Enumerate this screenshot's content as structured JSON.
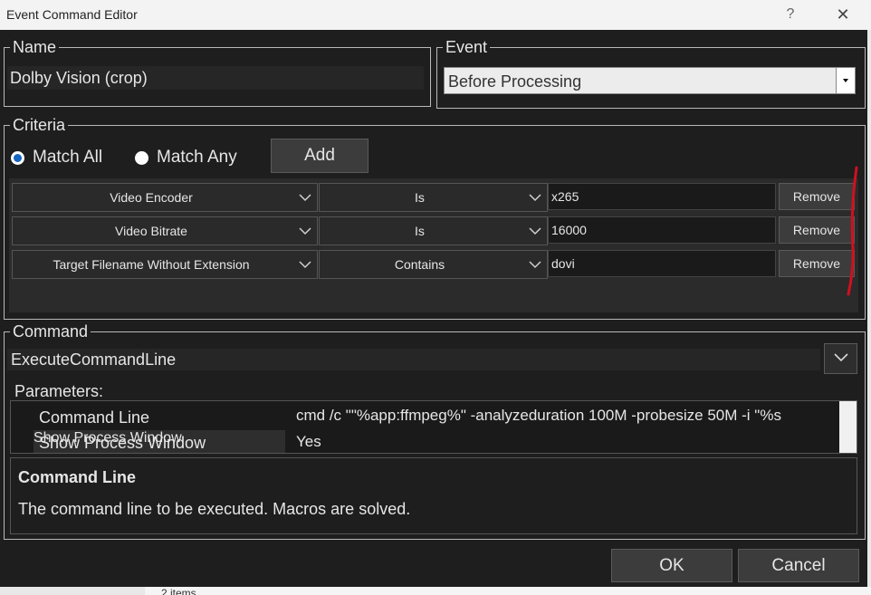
{
  "window": {
    "title": "Event Command Editor",
    "help": "?",
    "close": "✕"
  },
  "name": {
    "legend": "Name",
    "value": "Dolby Vision (crop)"
  },
  "event": {
    "legend": "Event",
    "value": "Before Processing"
  },
  "criteria": {
    "legend": "Criteria",
    "match_all": "Match All",
    "match_any": "Match Any",
    "selected": "Match All",
    "add_label": "Add",
    "rows": [
      {
        "field": "Video Encoder",
        "op": "Is",
        "value": "x265",
        "remove": "Remove"
      },
      {
        "field": "Video Bitrate",
        "op": "Is",
        "value": "16000",
        "remove": "Remove"
      },
      {
        "field": "Target Filename Without Extension",
        "op": "Contains",
        "value": "dovi",
        "remove": "Remove"
      }
    ]
  },
  "command": {
    "legend": "Command",
    "value": "ExecuteCommandLine",
    "parameters_label": "Parameters:",
    "params": [
      {
        "name": "Command Line",
        "value": "cmd /c \"\"%app:ffmpeg%\" -analyzeduration 100M -probesize 50M -i \"%s"
      },
      {
        "name": "Show Process Window",
        "value": "Yes"
      }
    ],
    "help_title": "Command Line",
    "help_text": "The command line to be executed. Macros are solved."
  },
  "footer": {
    "ok": "OK",
    "cancel": "Cancel"
  },
  "background": {
    "items_text": "2 items"
  },
  "colors": {
    "annotation": "#d01020",
    "radio_selected": "#1565c0"
  }
}
